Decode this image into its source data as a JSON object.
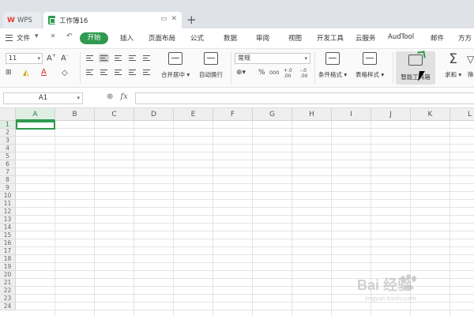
{
  "tabs": {
    "wps_label": "WPS",
    "doc_title": "工作簿16"
  },
  "menu": {
    "file_label": "文件",
    "more_symbol": "»",
    "items": {
      "start": "开始",
      "insert": "插入",
      "page_layout": "页面布局",
      "formula": "公式",
      "data": "数据",
      "review": "审阅",
      "view": "视图",
      "dev_tools": "开发工具",
      "cloud": "云服务",
      "audtool": "AudTool",
      "mail": "邮件",
      "fangfang": "方方"
    }
  },
  "ribbon": {
    "font_size": "11",
    "number_format": "常规",
    "merge_center": "合并居中",
    "wrap_text": "自动换行",
    "conditional_format": "条件格式",
    "table_style": "表格样式",
    "smart_toolbox": "智能工具箱",
    "sum": "求和",
    "filter_partial": "筛",
    "percent": "%",
    "thousands": "000",
    "dec_inc": "+.0 .00",
    "dec_dec": "-.0 .00"
  },
  "formula_bar": {
    "cell_ref": "A1",
    "fx_label": "fx"
  },
  "grid": {
    "columns": [
      "A",
      "B",
      "C",
      "D",
      "E",
      "F",
      "G",
      "H",
      "I",
      "J",
      "K",
      "L"
    ],
    "rows": [
      "1",
      "2",
      "3",
      "4",
      "5",
      "6",
      "7",
      "8",
      "9",
      "10",
      "11",
      "12",
      "13",
      "14",
      "15",
      "16",
      "17",
      "18",
      "19",
      "20",
      "21",
      "22",
      "23",
      "24"
    ],
    "selected_cell": "A1"
  },
  "watermark": {
    "brand_text": "Bai  经验",
    "url_text": "jingyan.baidu.com"
  },
  "colors": {
    "accent_green": "#2e9a4f",
    "wps_red": "#e53935"
  }
}
